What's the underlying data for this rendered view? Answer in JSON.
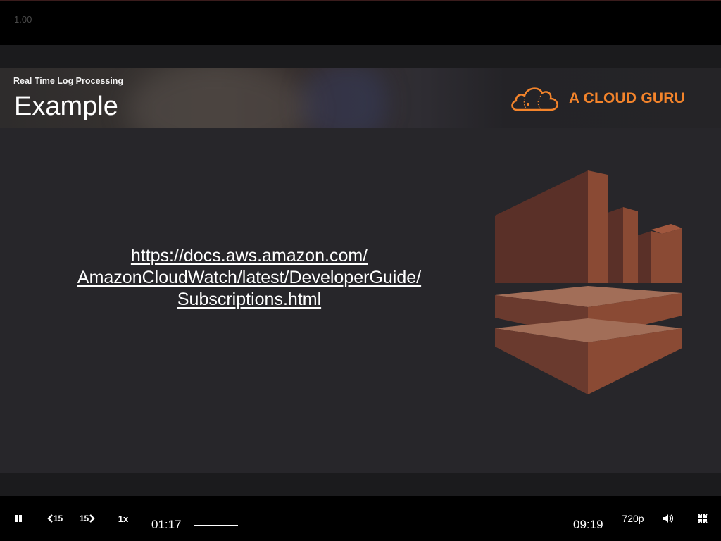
{
  "top_bar": {
    "rate_readout": "1.00"
  },
  "slide": {
    "subtitle": "Real Time Log Processing",
    "title": "Example",
    "brand": "A CLOUD GURU",
    "link_lines": [
      "https://docs.aws.amazon.com/",
      "AmazonCloudWatch/latest/DeveloperGuide/",
      "Subscriptions.html"
    ],
    "art_icon": "kinesis-icon"
  },
  "controls": {
    "play_state": "pause-icon",
    "rewind_label": "15",
    "forward_label": "15",
    "speed_label": "1x",
    "current_time": "01:17",
    "duration": "09:19",
    "quality_label": "720p",
    "volume_icon": "volume-icon",
    "fullscreen_icon": "exit-fullscreen-icon"
  },
  "colors": {
    "brand_orange": "#f4842b",
    "art_brown": "#8a4a34"
  }
}
